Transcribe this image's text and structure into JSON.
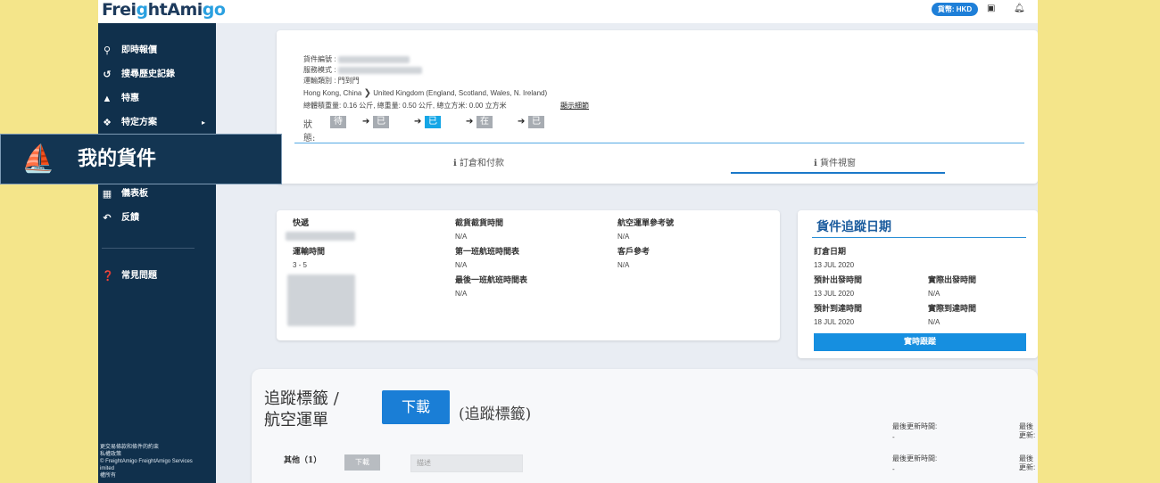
{
  "header": {
    "logo_part1": "Frei",
    "logo_part2": "g",
    "logo_part3": "htAmi",
    "logo_part4": "go",
    "currency_label": "貨幣: HKD",
    "screen_icon": "screen-icon",
    "bell_icon": "bell-icon"
  },
  "sidebar": {
    "items": [
      {
        "label": "即時報價",
        "icon": "search-icon"
      },
      {
        "label": "搜尋歷史記錄",
        "icon": "history-icon"
      },
      {
        "label": "特惠",
        "icon": "megaphone-icon"
      },
      {
        "label": "特定方案",
        "icon": "puzzle-icon",
        "arrow": "▸"
      },
      {
        "label": "儀表板",
        "icon": "dashboard-icon"
      },
      {
        "label": "反饋",
        "icon": "reply-icon"
      },
      {
        "label": "常見問題",
        "icon": "question-icon"
      }
    ],
    "footer_lines": [
      "更交易條款和條件的約束",
      "私權政策",
      "© FreightAmigo FreightAmigo Services",
      "imited",
      "權所有"
    ]
  },
  "overlay": {
    "label": "我的貨件",
    "icon": "ship-icon"
  },
  "shipment": {
    "number_label": "貨件編號 :",
    "service_label": "服務模式 :",
    "transport_label": "運輸類別 : 門到門",
    "origin": "Hong Kong, China",
    "destination": "United Kingdom (England, Scotland, Wales, N. Ireland)",
    "totals": "總體積重量: 0.16 公斤, 總重量: 0.50 公斤, 總立方米: 0.00 立方米",
    "show_details": "顯示細節",
    "status_label": "狀態:",
    "steps": [
      "待定",
      "已訂倉",
      "已確認",
      "在途中",
      "已完成"
    ],
    "active_step": 2,
    "tabs": [
      "ℹ 訂倉和付款",
      "ℹ 貨件視窗"
    ]
  },
  "details": {
    "courier_label": "快遞",
    "transit_label": "運輸時間",
    "transit_value": "3 - 5",
    "cutoff_label": "截貨截貨時間",
    "cutoff_value": "N/A",
    "first_flight_label": "第一班航班時間表",
    "first_flight_value": "N/A",
    "last_flight_label": "最後一班航班時間表",
    "last_flight_value": "N/A",
    "awb_label": "航空運單參考號",
    "awb_value": "N/A",
    "customer_ref_label": "客戶參考",
    "customer_ref_value": "N/A"
  },
  "tracking": {
    "title": "貨件追蹤日期",
    "booking_label": "訂倉日期",
    "booking_value": "13 JUL 2020",
    "etd_label": "預計出發時間",
    "etd_value": "13 JUL 2020",
    "atd_label": "實際出發時間",
    "atd_value": "N/A",
    "eta_label": "預計到達時間",
    "eta_value": "18 JUL 2020",
    "ata_label": "實際到達時間",
    "ata_value": "N/A",
    "button": "實時跟蹤"
  },
  "labels_section": {
    "title_line1": "追蹤標籤 /",
    "title_line2": "航空運單",
    "download_button": "下載",
    "download_note": "(追蹤標籤)",
    "last_update_time_label": "最後更新時間:",
    "last_update_time_value": "-",
    "last_update_label": "最後更新:",
    "last_update_value": "-",
    "other_label": "其他（1）",
    "other_download": "下載",
    "description_placeholder": "描述",
    "row2_time_label": "最後更新時間:",
    "row2_time_value": "-",
    "row2_update_label": "最後更新:",
    "row2_update_value": "-"
  },
  "colors": {
    "sidebar": "#10304c",
    "accent": "#1a7ed6",
    "active_step": "#15a6e6",
    "background_outer": "#f4e58a"
  }
}
